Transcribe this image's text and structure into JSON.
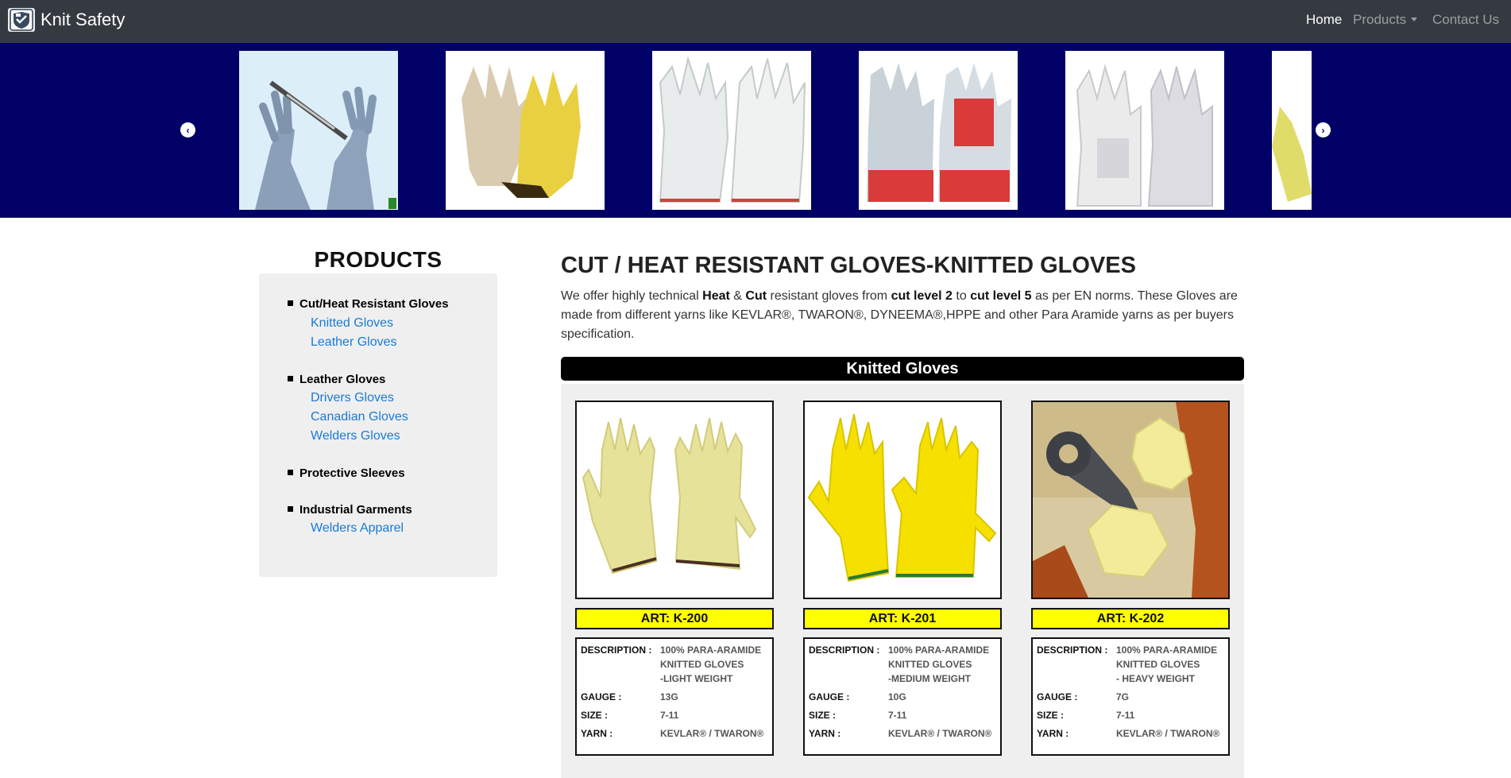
{
  "navbar": {
    "brand": "Knit Safety",
    "links": [
      {
        "label": "Home",
        "active": true
      },
      {
        "label": "Products",
        "dropdown": true
      },
      {
        "label": "Contact Us"
      }
    ],
    "background": "#343a40"
  },
  "carousel": {
    "background": "#000066",
    "slides": [
      {
        "icon": "grey-knitted-cut-glove-with-knife"
      },
      {
        "icon": "dotted-knitted-glove-with-leather-palm"
      },
      {
        "icon": "white-leather-driver-gloves"
      },
      {
        "icon": "red-canadian-gloves"
      },
      {
        "icon": "white-leather-welders-gloves"
      },
      {
        "icon": "yellow-knitted-glove"
      }
    ]
  },
  "sidebar": {
    "heading": "PRODUCTS",
    "categories": [
      {
        "label": "Cut/Heat Resistant Gloves",
        "items": [
          "Knitted Gloves",
          "Leather Gloves"
        ]
      },
      {
        "label": "Leather Gloves",
        "items": [
          "Drivers Gloves",
          "Canadian Gloves",
          "Welders Gloves"
        ]
      },
      {
        "label": "Protective Sleeves",
        "items": []
      },
      {
        "label": "Industrial Garments",
        "items": [
          "Welders Apparel"
        ]
      }
    ]
  },
  "main": {
    "title": "CUT / HEAT RESISTANT GLOVES-KNITTED GLOVES",
    "intro": {
      "p1": "We offer highly technical ",
      "b1": "Heat",
      "p2": " & ",
      "b2": "Cut",
      "p3": " resistant gloves from ",
      "b3": "cut level 2",
      "p4": " to ",
      "b4": "cut level 5",
      "p5": " as per EN norms. These Gloves are made from different yarns like KEVLAR®, TWARON®, DYNEEMA®,HPPE and other Para Aramide yarns as per buyers specification."
    },
    "section_title": "Knitted Gloves",
    "spec_labels": {
      "description": "DESCRIPTION :",
      "gauge": "GAUGE :",
      "size": "SIZE :",
      "yarn": "YARN :"
    },
    "products": [
      {
        "art": "ART: K-200",
        "description": "100% PARA-ARAMIDE\nKNITTED GLOVES\n-LIGHT WEIGHT",
        "gauge": "13G",
        "size": "7-11",
        "yarn": "KEVLAR® / TWARON®",
        "icon": "pale-yellow-knitted-gloves-pair"
      },
      {
        "art": "ART: K-201",
        "description": "100% PARA-ARAMIDE\nKNITTED GLOVES\n-MEDIUM WEIGHT",
        "gauge": "10G",
        "size": "7-11",
        "yarn": "KEVLAR® / TWARON®",
        "icon": "yellow-knitted-gloves-pair"
      },
      {
        "art": "ART: K-202",
        "description": "100% PARA-ARAMIDE\nKNITTED GLOVES\n- HEAVY WEIGHT",
        "gauge": "7G",
        "size": "7-11",
        "yarn": "KEVLAR® / TWARON®",
        "icon": "gloved-hands-with-wrench"
      }
    ],
    "accent_yellow": "#ffff00",
    "link_color": "#1a7ad6"
  }
}
